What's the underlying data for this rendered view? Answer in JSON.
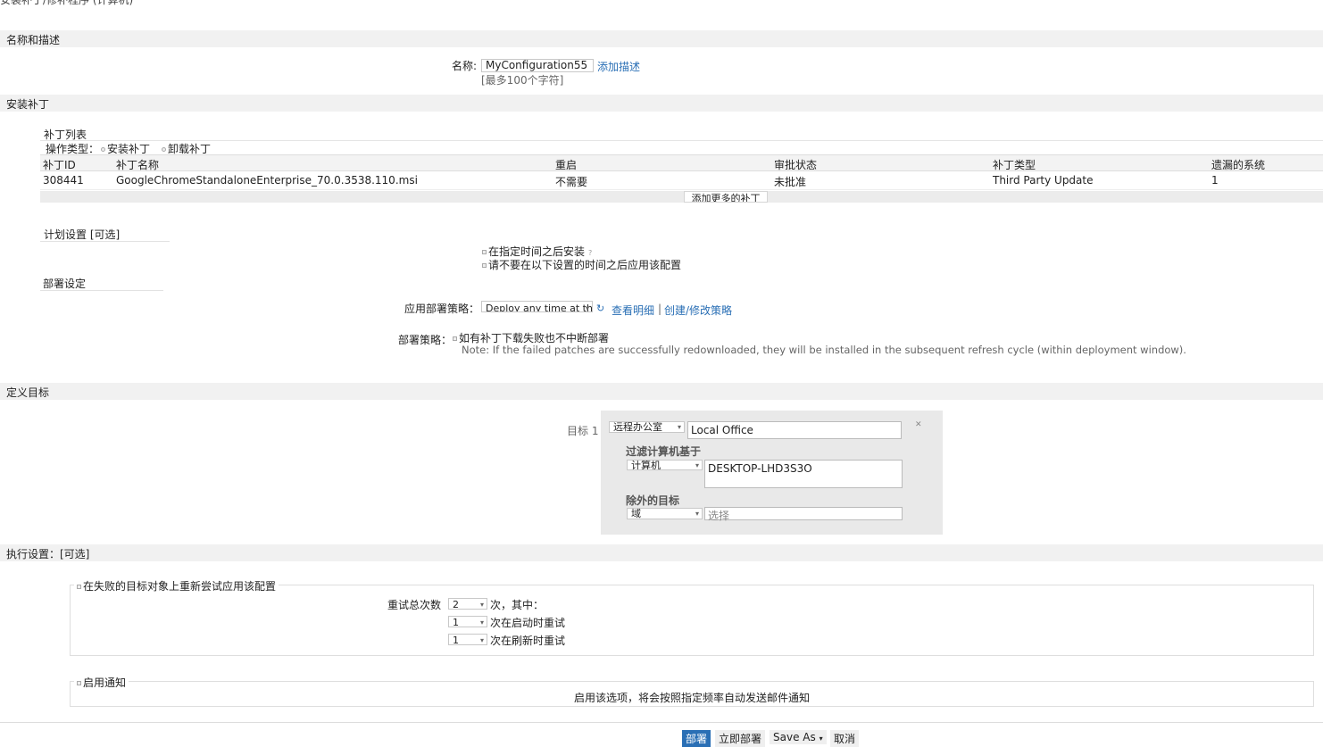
{
  "page_title_partial": "安装补丁/修补程序 (计算机)",
  "sections": {
    "name_desc": "名称和描述",
    "install_patch": "安装补丁",
    "define_target": "定义目标",
    "exec_settings": "执行设置：[可选]"
  },
  "name_field": {
    "label": "名称:",
    "value": "MyConfiguration55",
    "add_desc": "添加描述",
    "hint": "[最多100个字符]"
  },
  "patch_list": {
    "title": "补丁列表",
    "op_type_label": "操作类型：",
    "op_install": "安装补丁",
    "op_uninstall": "卸载补丁",
    "columns": [
      "补丁ID",
      "补丁名称",
      "重启",
      "审批状态",
      "补丁类型",
      "遗漏的系统"
    ],
    "rows": [
      [
        "308441",
        "GoogleChromeStandaloneEnterprise_70.0.3538.110.msi",
        "不需要",
        "未批准",
        "Third Party Update",
        "1"
      ]
    ],
    "add_more": "添加更多的补丁"
  },
  "schedule": {
    "title": "计划设置 [可选]",
    "opt_after_time": "在指定时间之后安装",
    "opt_not_after": "请不要在以下设置的时间之后应用该配置"
  },
  "deploy": {
    "title": "部署设定",
    "policy_label": "应用部署策略：",
    "policy_value": "Deploy any time at th",
    "view_detail": "查看明细",
    "separator": "|",
    "create_edit": "创建/修改策略",
    "strategy_label": "部署策略：",
    "strategy_option": "如有补丁下载失败也不中断部署",
    "note": "Note: If the failed patches are successfully redownloaded, they will be installed in the subsequent refresh cycle (within deployment window)."
  },
  "target": {
    "label": "目标 1",
    "type_value": "远程办公室",
    "type_text": "Local Office",
    "filter_title": "过滤计算机基于",
    "filter_type": "计算机",
    "filter_text": "DESKTOP-LHD3S3O",
    "exclude_title": "除外的目标",
    "exclude_type": "域",
    "exclude_placeholder": "选择"
  },
  "retry": {
    "legend": "在失败的目标对象上重新尝试应用该配置",
    "total_label": "重试总次数",
    "total_value": "2",
    "total_suffix": "次，其中：",
    "startup_value": "1",
    "startup_suffix": "次在启动时重试",
    "refresh_value": "1",
    "refresh_suffix": "次在刷新时重试"
  },
  "notify": {
    "legend": "启用通知",
    "desc": "启用该选项，将会按照指定频率自动发送邮件通知"
  },
  "footer": {
    "deploy": "部署",
    "deploy_now": "立即部署",
    "save_as": "Save As",
    "cancel": "取消"
  },
  "colors": {
    "section_bg": "#f1f1f1",
    "link": "#2a6fb5",
    "primary": "#2a6fb5",
    "panel_bg": "#e9e9e9"
  }
}
